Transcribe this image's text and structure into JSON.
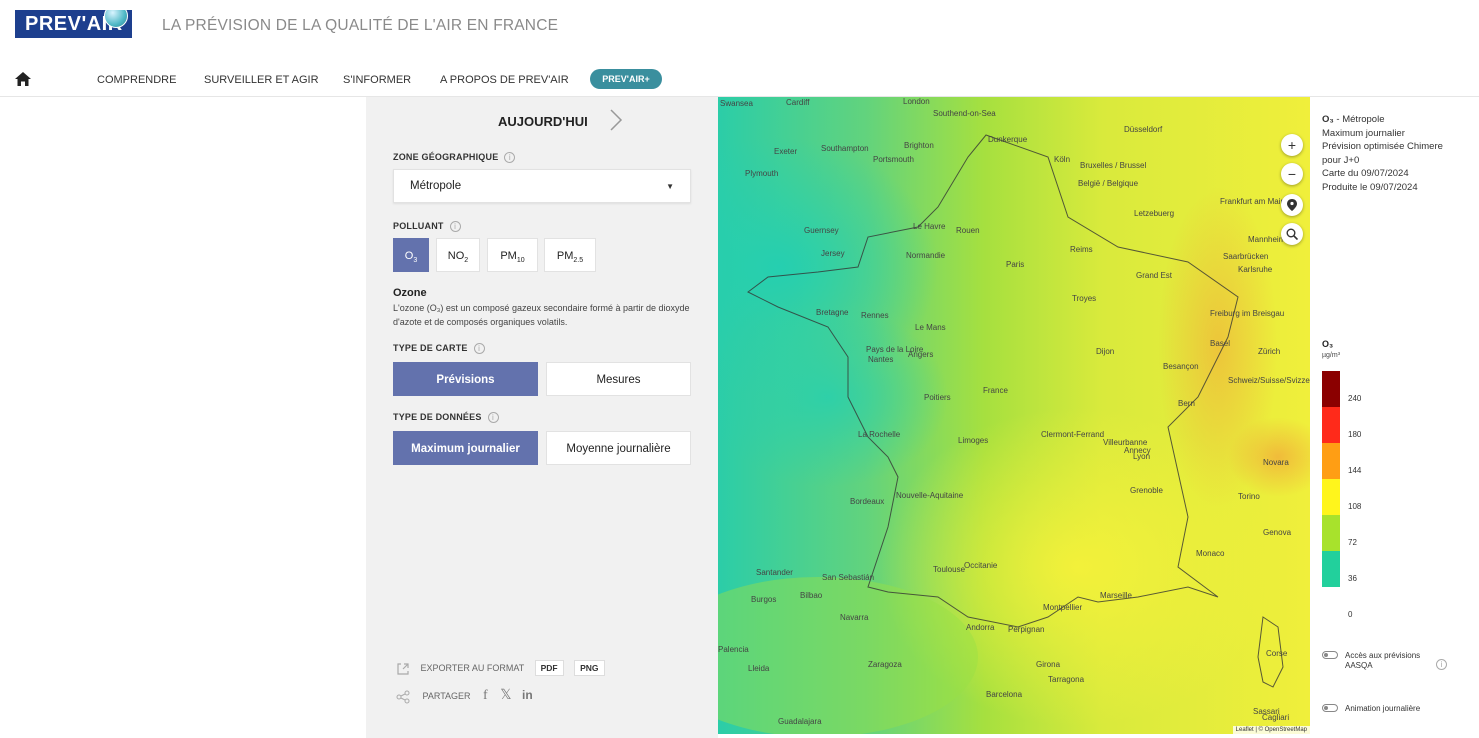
{
  "header": {
    "logo_text": "PREV'AIR",
    "tagline": "LA PRÉVISION DE LA QUALITÉ DE L'AIR EN FRANCE"
  },
  "nav": {
    "home_icon": "home-icon",
    "items": [
      "COMPRENDRE",
      "SURVEILLER ET AGIR",
      "S'INFORMER",
      "A PROPOS DE PREV'AIR"
    ],
    "plus_button": "PREV'AIR+"
  },
  "panel": {
    "date_label": "AUJOURD'HUI",
    "zone_label": "ZONE GÉOGRAPHIQUE",
    "zone_value": "Métropole",
    "polluant_label": "POLLUANT",
    "polluants": [
      {
        "label": "O",
        "sub": "3",
        "active": true
      },
      {
        "label": "NO",
        "sub": "2",
        "active": false
      },
      {
        "label": "PM",
        "sub": "10",
        "active": false
      },
      {
        "label": "PM",
        "sub": "2.5",
        "active": false
      }
    ],
    "pollutant_title": "Ozone",
    "pollutant_desc": "L'ozone (O₃) est un composé gazeux secondaire formé à partir de dioxyde d'azote et de composés organiques volatils.",
    "map_type_label": "TYPE DE CARTE",
    "map_types": [
      "Prévisions",
      "Mesures"
    ],
    "data_type_label": "TYPE DE DONNÉES",
    "data_types": [
      "Maximum journalier",
      "Moyenne journalière"
    ],
    "export_label": "EXPORTER AU FORMAT",
    "export_formats": [
      "PDF",
      "PNG"
    ],
    "share_label": "PARTAGER"
  },
  "map": {
    "labels": [
      "Swansea",
      "Cardiff",
      "London",
      "Southend-on-Sea",
      "Southampton",
      "Brighton",
      "Exeter",
      "Portsmouth",
      "Plymouth",
      "Dunkerque",
      "Düsseldorf",
      "Köln",
      "Bruxelles / Brussel",
      "België / Belgique",
      "Frankfurt am Main",
      "Letzebuerg",
      "Mannheim",
      "Saarbrücken",
      "Karlsruhe",
      "Guernsey",
      "Jersey",
      "Le Havre",
      "Rouen",
      "Normandie",
      "Reims",
      "Paris",
      "Grand Est",
      "Bretagne",
      "Rennes",
      "Le Mans",
      "Troyes",
      "Freiburg im Breisgau",
      "Nantes",
      "Angers",
      "Pays de la Loire",
      "Dijon",
      "Basel",
      "Zürich",
      "Besançon",
      "France",
      "Bern",
      "Poitiers",
      "Schweiz/Suisse/Svizzera",
      "La Rochelle",
      "Limoges",
      "Clermont-Ferrand",
      "Villeurbanne",
      "Lyon",
      "Annecy",
      "Novara",
      "Bordeaux",
      "Nouvelle-Aquitaine",
      "Grenoble",
      "Torino",
      "Genova",
      "Monaco",
      "Toulouse",
      "Occitanie",
      "Montpellier",
      "Marseille",
      "Santander",
      "San Sebastián",
      "Bilbao",
      "Burgos",
      "Navarra",
      "Andorra",
      "Perpignan",
      "Girona",
      "Zaragoza",
      "Barcelona",
      "Palencia",
      "Lleida",
      "Tarragona",
      "Guadalajara",
      "Corse",
      "Cagliari",
      "Sassari"
    ],
    "zoom_in": "+",
    "zoom_out": "−",
    "attribution": "Leaflet | © OpenStreetMap"
  },
  "info": {
    "line1_bold": "O₃",
    "line1": " - Métropole",
    "line2": "Maximum journalier",
    "line3": "Prévision optimisée Chimere",
    "line4": "pour J+0",
    "line5": "Carte du 09/07/2024",
    "line6": "Produite le 09/07/2024"
  },
  "legend": {
    "title": "O₃",
    "unit": "µg/m³",
    "ticks": [
      "240",
      "180",
      "144",
      "108",
      "72",
      "36",
      "0"
    ],
    "colors": [
      "#8b0000",
      "#ff2a1a",
      "#ff9e14",
      "#fff51c",
      "#a8e22c",
      "#22d09c"
    ]
  },
  "toggles": {
    "aasqa": "Accès aux prévisions AASQA",
    "animation": "Animation journalière"
  }
}
